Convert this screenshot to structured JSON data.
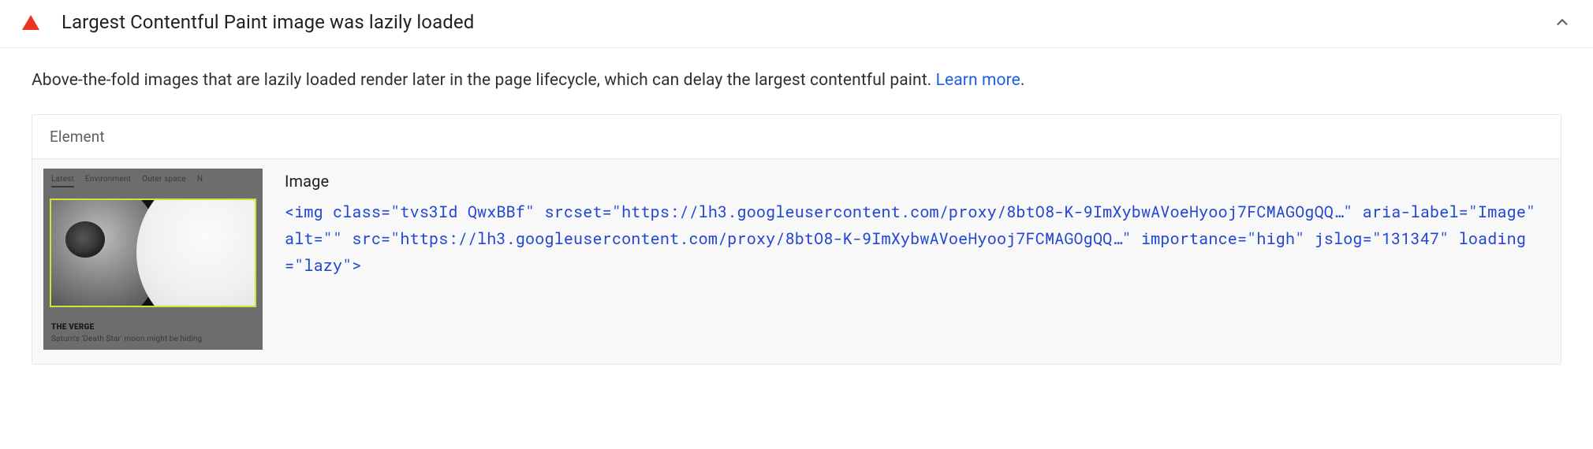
{
  "audit": {
    "title": "Largest Contentful Paint image was lazily loaded",
    "description_prefix": "Above-the-fold images that are lazily loaded render later in the page lifecycle, which can delay the largest contentful paint. ",
    "learn_more_label": "Learn more",
    "description_suffix": "."
  },
  "table": {
    "header": "Element",
    "row": {
      "label": "Image",
      "code": "<img class=\"tvs3Id QwxBBf\" srcset=\"https://lh3.googleusercontent.com/proxy/8btO8-K-9ImXybwAVoeHyooj7FCMAGOgQQ…\" aria-label=\"Image\" alt=\"\" src=\"https://lh3.googleusercontent.com/proxy/8btO8-K-9ImXybwAVoeHyooj7FCMAGOgQQ…\" importance=\"high\" jslog=\"131347\" loading=\"lazy\">"
    }
  },
  "thumbnail": {
    "tabs": [
      "Latest",
      "Environment",
      "Outer space",
      "N"
    ],
    "brand": "THE VERGE",
    "caption": "Saturn's 'Death Star' moon might be hiding"
  }
}
